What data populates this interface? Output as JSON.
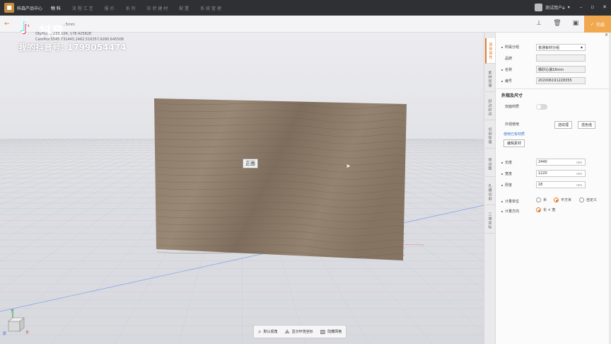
{
  "app": {
    "name": "科森产品中心",
    "menu": [
      "物 料",
      "流 程 工 艺",
      "报 价",
      "系 列",
      "形 状 建 材",
      "配 置",
      "系 统 管 理"
    ],
    "active_menu": 0,
    "user_name": "测试用户a"
  },
  "toolbar": {
    "back_icon": "arrow-left-icon",
    "done_label": "完成",
    "panel_close": "✕"
  },
  "watermark": {
    "logo": "♪",
    "name": "抖音",
    "id_text": "我的抖音号: 1799054474"
  },
  "coords": {
    "line1": "ObjPos:... 233,104, 178.425828",
    "line2": "CamPos:5545.731445,1462.516357,6280.645508",
    "tab_title": "...5mm"
  },
  "viewport": {
    "front_label": "正面"
  },
  "axis": {
    "y": "宽",
    "x": "长",
    "z": "厚"
  },
  "bottom_bar": {
    "items": [
      "默认视角",
      "显示环境坐标",
      "隐藏网格"
    ]
  },
  "side_tabs": [
    "基础属性",
    "素材管理",
    "封边封边",
    "切割管理",
    "修边图",
    "孔槽切割",
    "三维坐标"
  ],
  "panel": {
    "category_label": "所属分组",
    "category_value": "普通板材分组",
    "brand_label": "品牌",
    "brand_value": "",
    "name_label": "名称",
    "name_value": "橡砂沁濡18mm",
    "code_label": "编号",
    "code_value": "202006191228355",
    "size_section": "外观及尺寸",
    "double_side_label": "双面材质",
    "appearance_label": "外观使用",
    "btn_texture": "选纹理",
    "btn_color": "选色值",
    "used_material_link": "使用已有材质",
    "edit_material_btn": "编辑素材",
    "length_label": "长度",
    "length_value": "2440",
    "width_label": "宽度",
    "width_value": "1220",
    "thickness_label": "厚度",
    "thickness_value": "18",
    "unit": "mm",
    "calc_unit_label": "计量单位",
    "calc_units": [
      "米",
      "平方米",
      "自定义"
    ],
    "calc_unit_selected": 1,
    "direction_label": "计量方向",
    "direction_value": "长 × 宽"
  },
  "colors": {
    "accent": "#e07c2f",
    "done": "#f0a94f",
    "titlebar": "#2f3034"
  }
}
